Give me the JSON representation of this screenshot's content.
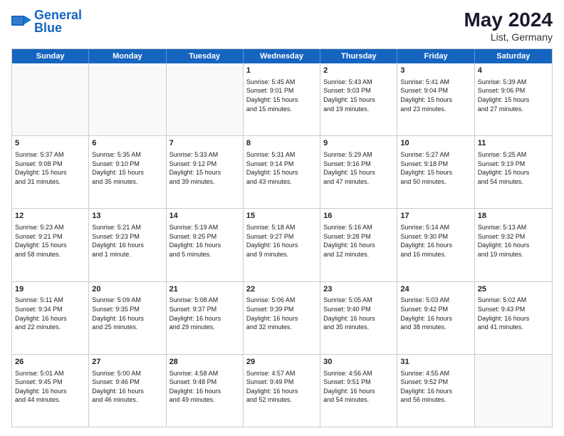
{
  "header": {
    "logo_line1": "General",
    "logo_line2": "Blue",
    "month_year": "May 2024",
    "location": "List, Germany"
  },
  "weekdays": [
    "Sunday",
    "Monday",
    "Tuesday",
    "Wednesday",
    "Thursday",
    "Friday",
    "Saturday"
  ],
  "rows": [
    [
      {
        "day": "",
        "text": ""
      },
      {
        "day": "",
        "text": ""
      },
      {
        "day": "",
        "text": ""
      },
      {
        "day": "1",
        "text": "Sunrise: 5:45 AM\nSunset: 9:01 PM\nDaylight: 15 hours\nand 15 minutes."
      },
      {
        "day": "2",
        "text": "Sunrise: 5:43 AM\nSunset: 9:03 PM\nDaylight: 15 hours\nand 19 minutes."
      },
      {
        "day": "3",
        "text": "Sunrise: 5:41 AM\nSunset: 9:04 PM\nDaylight: 15 hours\nand 23 minutes."
      },
      {
        "day": "4",
        "text": "Sunrise: 5:39 AM\nSunset: 9:06 PM\nDaylight: 15 hours\nand 27 minutes."
      }
    ],
    [
      {
        "day": "5",
        "text": "Sunrise: 5:37 AM\nSunset: 9:08 PM\nDaylight: 15 hours\nand 31 minutes."
      },
      {
        "day": "6",
        "text": "Sunrise: 5:35 AM\nSunset: 9:10 PM\nDaylight: 15 hours\nand 35 minutes."
      },
      {
        "day": "7",
        "text": "Sunrise: 5:33 AM\nSunset: 9:12 PM\nDaylight: 15 hours\nand 39 minutes."
      },
      {
        "day": "8",
        "text": "Sunrise: 5:31 AM\nSunset: 9:14 PM\nDaylight: 15 hours\nand 43 minutes."
      },
      {
        "day": "9",
        "text": "Sunrise: 5:29 AM\nSunset: 9:16 PM\nDaylight: 15 hours\nand 47 minutes."
      },
      {
        "day": "10",
        "text": "Sunrise: 5:27 AM\nSunset: 9:18 PM\nDaylight: 15 hours\nand 50 minutes."
      },
      {
        "day": "11",
        "text": "Sunrise: 5:25 AM\nSunset: 9:19 PM\nDaylight: 15 hours\nand 54 minutes."
      }
    ],
    [
      {
        "day": "12",
        "text": "Sunrise: 5:23 AM\nSunset: 9:21 PM\nDaylight: 15 hours\nand 58 minutes."
      },
      {
        "day": "13",
        "text": "Sunrise: 5:21 AM\nSunset: 9:23 PM\nDaylight: 16 hours\nand 1 minute."
      },
      {
        "day": "14",
        "text": "Sunrise: 5:19 AM\nSunset: 9:25 PM\nDaylight: 16 hours\nand 5 minutes."
      },
      {
        "day": "15",
        "text": "Sunrise: 5:18 AM\nSunset: 9:27 PM\nDaylight: 16 hours\nand 9 minutes."
      },
      {
        "day": "16",
        "text": "Sunrise: 5:16 AM\nSunset: 9:28 PM\nDaylight: 16 hours\nand 12 minutes."
      },
      {
        "day": "17",
        "text": "Sunrise: 5:14 AM\nSunset: 9:30 PM\nDaylight: 16 hours\nand 16 minutes."
      },
      {
        "day": "18",
        "text": "Sunrise: 5:13 AM\nSunset: 9:32 PM\nDaylight: 16 hours\nand 19 minutes."
      }
    ],
    [
      {
        "day": "19",
        "text": "Sunrise: 5:11 AM\nSunset: 9:34 PM\nDaylight: 16 hours\nand 22 minutes."
      },
      {
        "day": "20",
        "text": "Sunrise: 5:09 AM\nSunset: 9:35 PM\nDaylight: 16 hours\nand 25 minutes."
      },
      {
        "day": "21",
        "text": "Sunrise: 5:08 AM\nSunset: 9:37 PM\nDaylight: 16 hours\nand 29 minutes."
      },
      {
        "day": "22",
        "text": "Sunrise: 5:06 AM\nSunset: 9:39 PM\nDaylight: 16 hours\nand 32 minutes."
      },
      {
        "day": "23",
        "text": "Sunrise: 5:05 AM\nSunset: 9:40 PM\nDaylight: 16 hours\nand 35 minutes."
      },
      {
        "day": "24",
        "text": "Sunrise: 5:03 AM\nSunset: 9:42 PM\nDaylight: 16 hours\nand 38 minutes."
      },
      {
        "day": "25",
        "text": "Sunrise: 5:02 AM\nSunset: 9:43 PM\nDaylight: 16 hours\nand 41 minutes."
      }
    ],
    [
      {
        "day": "26",
        "text": "Sunrise: 5:01 AM\nSunset: 9:45 PM\nDaylight: 16 hours\nand 44 minutes."
      },
      {
        "day": "27",
        "text": "Sunrise: 5:00 AM\nSunset: 9:46 PM\nDaylight: 16 hours\nand 46 minutes."
      },
      {
        "day": "28",
        "text": "Sunrise: 4:58 AM\nSunset: 9:48 PM\nDaylight: 16 hours\nand 49 minutes."
      },
      {
        "day": "29",
        "text": "Sunrise: 4:57 AM\nSunset: 9:49 PM\nDaylight: 16 hours\nand 52 minutes."
      },
      {
        "day": "30",
        "text": "Sunrise: 4:56 AM\nSunset: 9:51 PM\nDaylight: 16 hours\nand 54 minutes."
      },
      {
        "day": "31",
        "text": "Sunrise: 4:55 AM\nSunset: 9:52 PM\nDaylight: 16 hours\nand 56 minutes."
      },
      {
        "day": "",
        "text": ""
      }
    ]
  ]
}
